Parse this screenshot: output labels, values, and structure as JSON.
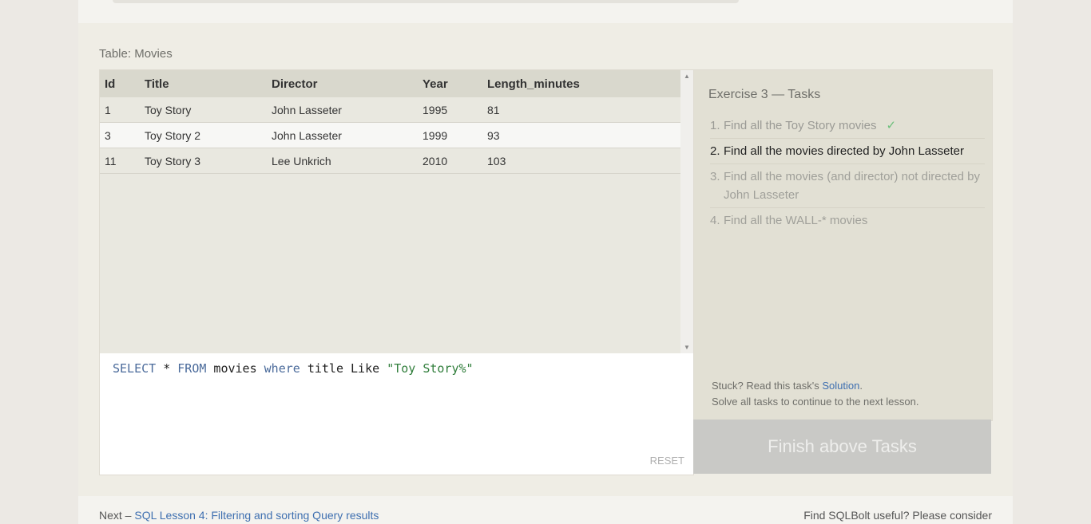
{
  "table": {
    "title": "Table: Movies",
    "columns": [
      "Id",
      "Title",
      "Director",
      "Year",
      "Length_minutes"
    ],
    "rows": [
      [
        "1",
        "Toy Story",
        "John Lasseter",
        "1995",
        "81"
      ],
      [
        "3",
        "Toy Story 2",
        "John Lasseter",
        "1999",
        "93"
      ],
      [
        "11",
        "Toy Story 3",
        "Lee Unkrich",
        "2010",
        "103"
      ]
    ]
  },
  "editor": {
    "query_tokens": [
      "SELECT",
      " * ",
      "FROM",
      " movies ",
      "where",
      " title Like ",
      "\"Toy Story%\""
    ],
    "reset_label": "RESET"
  },
  "tasks": {
    "title": "Exercise 3 — Tasks",
    "items": [
      {
        "num": "1.",
        "text": "Find all the Toy Story movies",
        "status": "done",
        "check": "✓"
      },
      {
        "num": "2.",
        "text": "Find all the movies directed by John Lasseter",
        "status": "current"
      },
      {
        "num": "3.",
        "text": "Find all the movies (and director) not directed by John Lasseter",
        "status": "pending"
      },
      {
        "num": "4.",
        "text": "Find all the WALL-* movies",
        "status": "pending"
      }
    ],
    "stuck_prefix": "Stuck? Read this task's ",
    "solution_link": "Solution",
    "stuck_suffix": ".",
    "solve_all": "Solve all tasks to continue to the next lesson.",
    "finish_button": "Finish above Tasks"
  },
  "footer": {
    "next_prefix": "Next – ",
    "next_link": "SQL Lesson 4: Filtering and sorting Query results",
    "right_text": "Find SQLBolt useful? Please consider"
  },
  "colors": {
    "link": "#3e6fb0",
    "keyword": "#4b6b9b",
    "string": "#2f7d3a",
    "check": "#6bbf7a"
  }
}
